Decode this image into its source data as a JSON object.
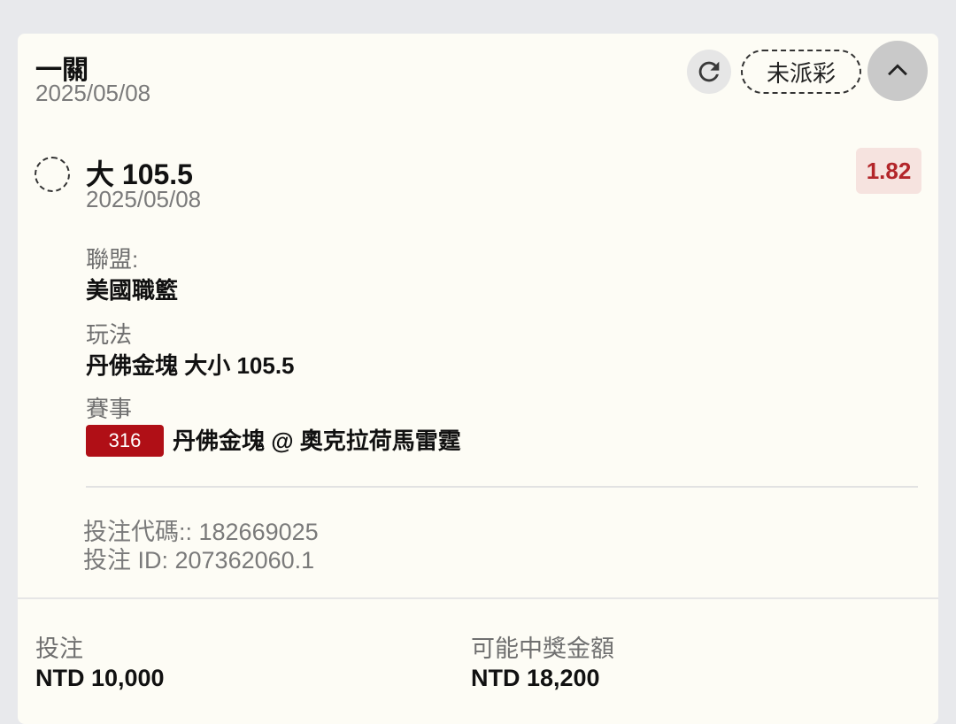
{
  "bet": {
    "type": "一關",
    "date": "2025/05/08",
    "status": "未派彩",
    "icons": {
      "refresh": "refresh-icon",
      "collapse": "chevron-up-icon"
    }
  },
  "selection": {
    "name": "大 105.5",
    "date": "2025/05/08",
    "odds": "1.82",
    "league_label": "聯盟:",
    "league": "美國職籃",
    "market_label": "玩法",
    "market": "丹佛金塊 大小 105.5",
    "event_label": "賽事",
    "match_number": "316",
    "match": "丹佛金塊 @ 奧克拉荷馬雷霆"
  },
  "ids": {
    "bet_code": "投注代碼:: 182669025",
    "bet_id": "投注 ID: 207362060.1"
  },
  "footer": {
    "stake_label": "投注",
    "stake_value": "NTD 10,000",
    "payout_label": "可能中獎金額",
    "payout_value": "NTD 18,200"
  },
  "colors": {
    "accent": "#b00f16",
    "odds_text": "#b3262a",
    "odds_bg": "#f6e3df",
    "card_bg": "#fdfcf5"
  }
}
